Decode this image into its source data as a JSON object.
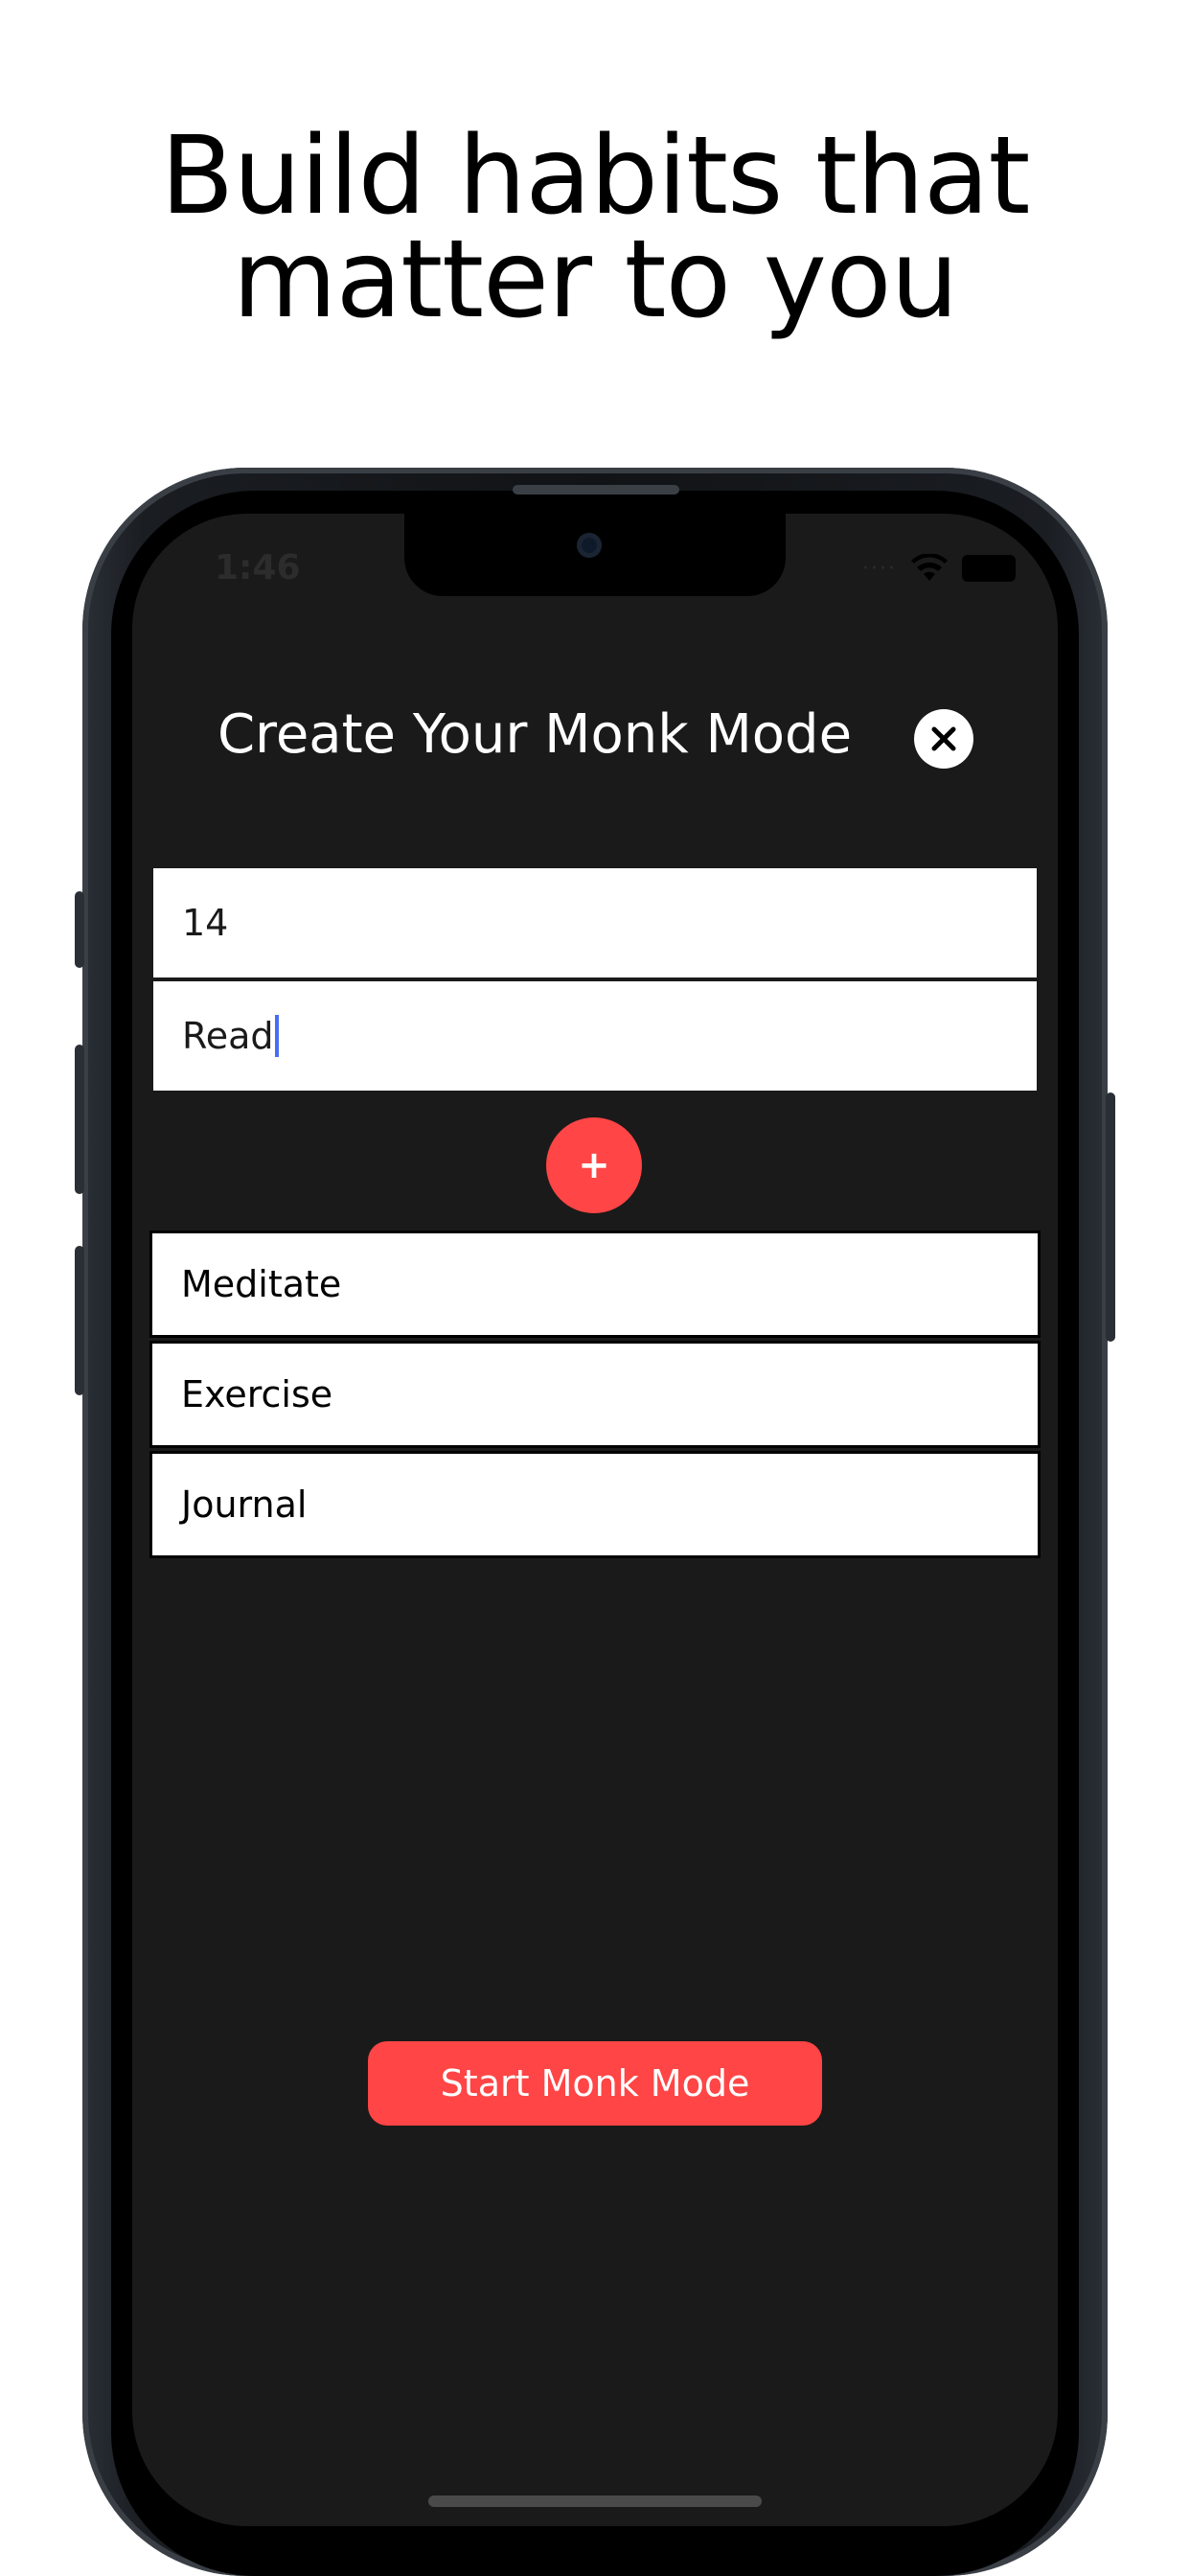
{
  "headline": {
    "line1": "Build habits that",
    "line2": "matter to you"
  },
  "status_bar": {
    "time": "1:46",
    "icons": [
      "signal-dots-icon",
      "wifi-icon",
      "battery-icon"
    ]
  },
  "screen": {
    "title": "Create Your Monk Mode",
    "close_icon": "close-icon"
  },
  "form": {
    "days_value": "14",
    "habit_value": "Read",
    "add_label": "+"
  },
  "habits": [
    {
      "label": "Meditate"
    },
    {
      "label": "Exercise"
    },
    {
      "label": "Journal"
    }
  ],
  "start_button": {
    "label": "Start Monk Mode"
  },
  "colors": {
    "accent": "#ff4545",
    "screen_bg": "#1a1a1a",
    "caret": "#4a6cf7"
  }
}
